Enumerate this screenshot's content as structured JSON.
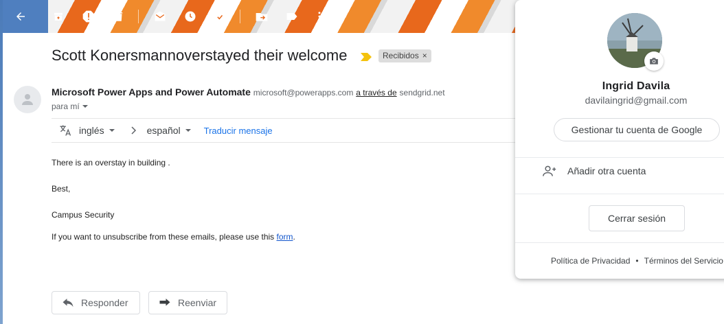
{
  "toolbar": {
    "icons": [
      "back-arrow-icon",
      "archive-icon",
      "report-spam-icon",
      "delete-icon",
      "mark-unread-icon",
      "snooze-icon",
      "add-to-tasks-icon",
      "move-to-icon",
      "labels-icon",
      "more-vert-icon"
    ]
  },
  "email": {
    "subject": "Scott Konersmannoverstayed their welcome",
    "label_chip": "Recibidos",
    "label_chip_close": "×",
    "sender_name": "Microsoft Power Apps and Power Automate",
    "sender_email": "microsoft@powerapps.com",
    "via_text": "a través de",
    "via_domain": "sendgrid.net",
    "to_text": "para mí",
    "translate": {
      "from_lang": "inglés",
      "to_lang": "español",
      "action": "Traducir mensaje"
    },
    "body_line1": "There is an overstay in building .",
    "body_line2": "Best,",
    "body_line3": "Campus Security",
    "body_line4_pre": "If you want to unsubscribe from these emails, please use this ",
    "body_line4_link": "form",
    "body_line4_post": "."
  },
  "actions": {
    "reply_label": "Responder",
    "forward_label": "Reenviar"
  },
  "account_popup": {
    "name": "Ingrid Davila",
    "email": "davilaingrid@gmail.com",
    "manage_label": "Gestionar tu cuenta de Google",
    "add_account_label": "Añadir otra cuenta",
    "signout_label": "Cerrar sesión",
    "privacy_label": "Política de Privacidad",
    "dot": "•",
    "terms_label": "Términos del Servicio"
  },
  "colors": {
    "accent_link": "#1a73e8",
    "important_marker": "#f4c20d",
    "theme_orange": "#e8681c"
  }
}
